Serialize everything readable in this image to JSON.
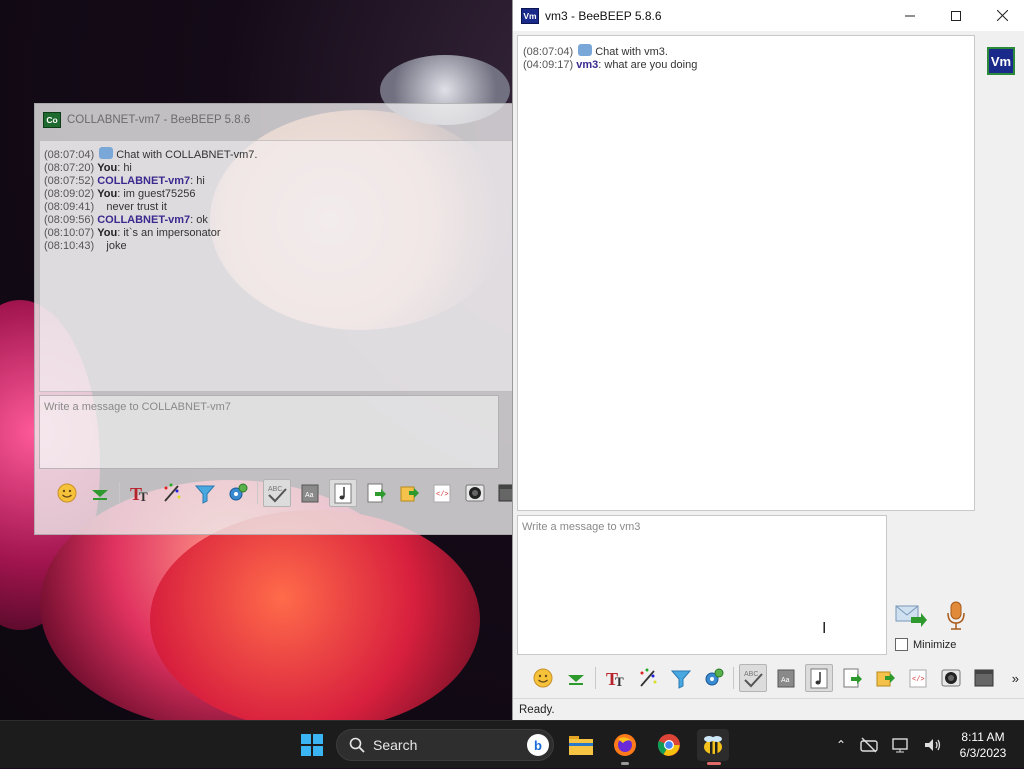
{
  "left_window": {
    "title": "COLLABNET-vm7 - BeeBEEP 5.8.6",
    "icon_label": "Co",
    "chat": [
      {
        "time": "(08:07:04)",
        "system": true,
        "sender": "",
        "text": "Chat with COLLABNET-vm7."
      },
      {
        "time": "(08:07:20)",
        "sender": "You",
        "kind": "me",
        "text": "hi"
      },
      {
        "time": "(08:07:52)",
        "sender": "COLLABNET-vm7",
        "kind": "peer",
        "text": "hi"
      },
      {
        "time": "(08:09:02)",
        "sender": "You",
        "kind": "me",
        "text": "im guest75256"
      },
      {
        "time": "(08:09:41)",
        "sender": "",
        "kind": "cont",
        "text": "never trust it"
      },
      {
        "time": "(08:09:56)",
        "sender": "COLLABNET-vm7",
        "kind": "peer",
        "text": "ok"
      },
      {
        "time": "(08:10:07)",
        "sender": "You",
        "kind": "me",
        "text": "it`s an impersonator"
      },
      {
        "time": "(08:10:43)",
        "sender": "",
        "kind": "cont",
        "text": "joke"
      }
    ],
    "input_placeholder": "Write a message to COLLABNET-vm7"
  },
  "right_window": {
    "title": "vm3 - BeeBEEP 5.8.6",
    "icon_label": "Vm",
    "chat": [
      {
        "time": "(08:07:04)",
        "system": true,
        "sender": "",
        "text": "Chat with vm3."
      },
      {
        "time": "(04:09:17)",
        "sender": "vm3",
        "kind": "peer",
        "text": "what are you doing"
      }
    ],
    "input_placeholder": "Write a message to vm3",
    "user_avatar": "Vm",
    "minimize_label": "Minimize",
    "status": "Ready."
  },
  "toolbar_icons": [
    "emoji-icon",
    "collapse-icon",
    "text-font-icon",
    "text-color-icon",
    "filter-icon",
    "settings-icon",
    "spellcheck-icon",
    "dictionary-icon",
    "sound-icon",
    "save-chat-icon",
    "send-file-icon",
    "screenshot-icon",
    "camera-icon",
    "archive-icon"
  ],
  "taskbar": {
    "search_label": "Search",
    "time": "8:11 AM",
    "date": "6/3/2023"
  }
}
